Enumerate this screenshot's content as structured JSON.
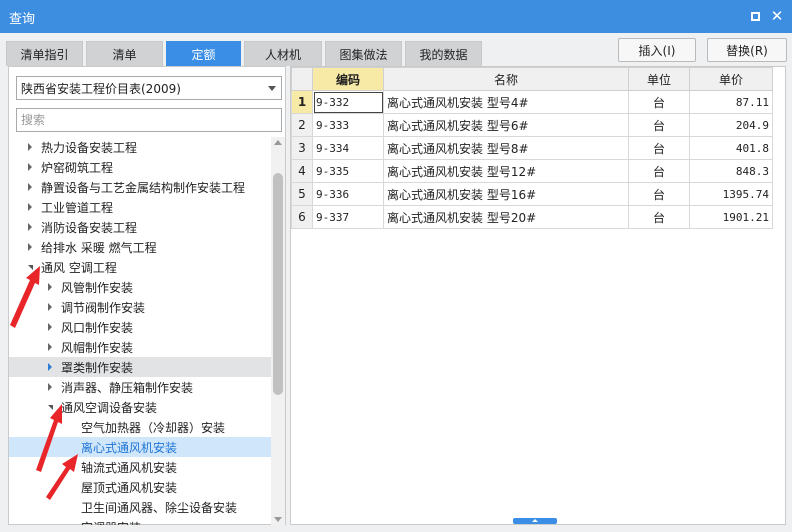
{
  "window": {
    "title": "查询"
  },
  "tabs": [
    {
      "label": "清单指引",
      "active": false
    },
    {
      "label": "清单",
      "active": false
    },
    {
      "label": "定额",
      "active": true
    },
    {
      "label": "人材机",
      "active": false
    },
    {
      "label": "图集做法",
      "active": false
    },
    {
      "label": "我的数据",
      "active": false
    }
  ],
  "toolbar": {
    "insert_label": "插入(I)",
    "replace_label": "替换(R)"
  },
  "library_select": {
    "value": "陕西省安装工程价目表(2009)"
  },
  "search": {
    "placeholder": "搜索"
  },
  "tree": [
    {
      "label": "热力设备安装工程",
      "level": 0,
      "state": "collapsed"
    },
    {
      "label": "炉窑砌筑工程",
      "level": 0,
      "state": "collapsed"
    },
    {
      "label": "静置设备与工艺金属结构制作安装工程",
      "level": 0,
      "state": "collapsed"
    },
    {
      "label": "工业管道工程",
      "level": 0,
      "state": "collapsed"
    },
    {
      "label": "消防设备安装工程",
      "level": 0,
      "state": "collapsed"
    },
    {
      "label": "给排水 采暖 燃气工程",
      "level": 0,
      "state": "collapsed"
    },
    {
      "label": "通风 空调工程",
      "level": 0,
      "state": "expanded"
    },
    {
      "label": "风管制作安装",
      "level": 1,
      "state": "collapsed"
    },
    {
      "label": "调节阀制作安装",
      "level": 1,
      "state": "collapsed"
    },
    {
      "label": "风口制作安装",
      "level": 1,
      "state": "collapsed"
    },
    {
      "label": "风帽制作安装",
      "level": 1,
      "state": "collapsed"
    },
    {
      "label": "罩类制作安装",
      "level": 1,
      "state": "collapsed",
      "hover": true
    },
    {
      "label": "消声器、静压箱制作安装",
      "level": 1,
      "state": "collapsed"
    },
    {
      "label": "通风空调设备安装",
      "level": 1,
      "state": "expanded"
    },
    {
      "label": "空气加热器（冷却器）安装",
      "level": 2,
      "state": "leaf"
    },
    {
      "label": "离心式通风机安装",
      "level": 2,
      "state": "leaf",
      "selected": true
    },
    {
      "label": "轴流式通风机安装",
      "level": 2,
      "state": "leaf"
    },
    {
      "label": "屋顶式通风机安装",
      "level": 2,
      "state": "leaf"
    },
    {
      "label": "卫生间通风器、除尘设备安装",
      "level": 2,
      "state": "leaf"
    },
    {
      "label": "空调器安装",
      "level": 2,
      "state": "leaf"
    }
  ],
  "grid": {
    "headers": {
      "code": "编码",
      "name": "名称",
      "unit": "单位",
      "price": "单价"
    },
    "rows": [
      {
        "num": "1",
        "code": "9-332",
        "name": "离心式通风机安装 型号4#",
        "unit": "台",
        "price": "87.11"
      },
      {
        "num": "2",
        "code": "9-333",
        "name": "离心式通风机安装 型号6#",
        "unit": "台",
        "price": "204.9"
      },
      {
        "num": "3",
        "code": "9-334",
        "name": "离心式通风机安装 型号8#",
        "unit": "台",
        "price": "401.8"
      },
      {
        "num": "4",
        "code": "9-335",
        "name": "离心式通风机安装 型号12#",
        "unit": "台",
        "price": "848.3"
      },
      {
        "num": "5",
        "code": "9-336",
        "name": "离心式通风机安装 型号16#",
        "unit": "台",
        "price": "1395.74"
      },
      {
        "num": "6",
        "code": "9-337",
        "name": "离心式通风机安装 型号20#",
        "unit": "台",
        "price": "1901.21"
      }
    ]
  },
  "colors": {
    "title_bar": "#3d8ee0",
    "active_tab": "#3a8ee6",
    "selected_row": "#cfe6fb",
    "annotation": "#e8262a"
  }
}
